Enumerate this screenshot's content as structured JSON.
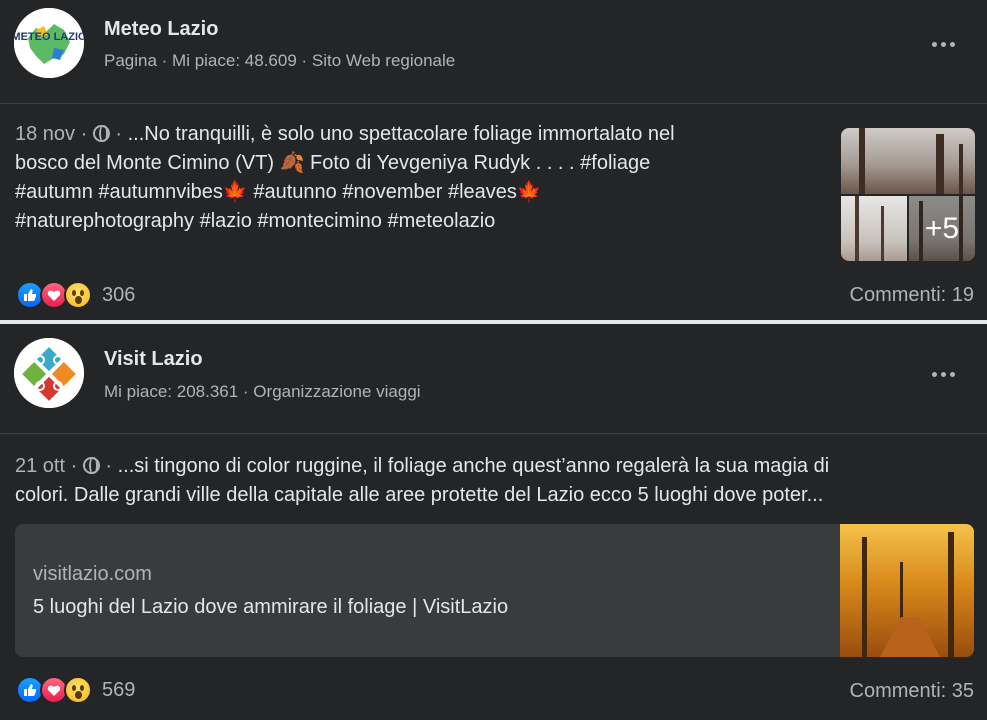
{
  "posts": [
    {
      "page_name": "Meteo Lazio",
      "page_meta": "Pagina · Mi piace: 48.609 · Sito Web regionale",
      "avatar_text": "METEO LAZIO",
      "date": "18 nov",
      "dot": " · ",
      "text_lines": [
        "...No tranquilli, è solo uno spettacolare foliage immortalato nel",
        "bosco del Monte Cimino (VT) 🍂 Foto di Yevgeniya Rudyk . . . . #foliage",
        "#autumn #autumnvibes🍁 #autunno #november #leaves🍁",
        "#naturephotography #lazio #montecimino #meteolazio"
      ],
      "gallery_more": "+5",
      "reaction_count": "306",
      "comments": "Commenti: 19"
    },
    {
      "page_name": "Visit Lazio",
      "page_meta": "Mi piace: 208.361 · Organizzazione viaggi",
      "date": "21 ott",
      "dot": " · ",
      "text_lines": [
        "...si tingono di color ruggine, il foliage anche quest’anno regalerà la sua magia di",
        "colori. Dalle grandi ville della capitale alle aree protette del Lazio ecco 5 luoghi dove poter..."
      ],
      "link_domain": "visitlazio.com",
      "link_title": "5 luoghi del Lazio dove ammirare il foliage | VisitLazio",
      "reaction_count": "569",
      "comments": "Commenti: 35"
    }
  ]
}
